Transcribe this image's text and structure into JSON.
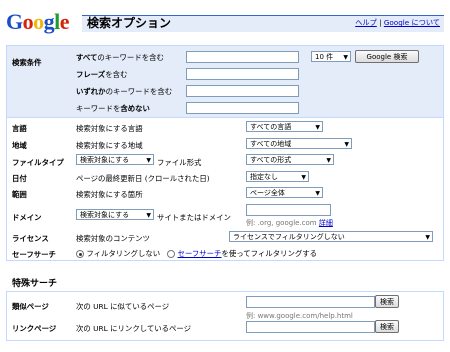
{
  "header": {
    "logo_letters": [
      "G",
      "o",
      "o",
      "g",
      "l",
      "e"
    ],
    "logo_colors": [
      "#1a4ec8",
      "#d62408",
      "#f2b50e",
      "#1a4ec8",
      "#1f9a2e",
      "#d62408"
    ],
    "title": "検索オプション",
    "help_link": "ヘルプ",
    "separator": "|",
    "about_link": "Google について"
  },
  "keywords": {
    "section_label": "検索条件",
    "rows": [
      {
        "bold": "すべて",
        "rest": "のキーワードを含む"
      },
      {
        "bold": "フレーズ",
        "rest": "を含む"
      },
      {
        "bold": "いずれか",
        "rest": "のキーワードを含む"
      },
      {
        "bold": "",
        "rest": "キーワードを",
        "bold2": "含めない"
      }
    ],
    "results_select": "10 件",
    "search_button": "Google 検索"
  },
  "options": [
    {
      "label": "言語",
      "desc": "検索対象にする言語",
      "select": "すべての言語"
    },
    {
      "label": "地域",
      "desc": "検索対象にする地域",
      "select": "すべての地域"
    },
    {
      "label": "ファイルタイプ",
      "pre_select": "検索対象にする",
      "desc": "ファイル形式",
      "select": "すべての形式"
    },
    {
      "label": "日付",
      "desc": "ページの最終更新日 (クロールされた日)",
      "select": "指定なし"
    },
    {
      "label": "範囲",
      "desc": "検索対象にする箇所",
      "select": "ページ全体"
    },
    {
      "label": "ドメイン",
      "pre_select": "検索対象にする",
      "desc": "サイトまたはドメイン"
    },
    {
      "label": "ライセンス",
      "desc": "検索対象のコンテンツ",
      "select": "ライセンスでフィルタリングしない"
    }
  ],
  "domain_hint": {
    "example": "例: .org, google.com",
    "detail_link": "詳細"
  },
  "safesearch": {
    "label": "セーフサーチ",
    "option_off": "フィルタリングしない",
    "option_on_link": "セーフサーチ",
    "option_on_rest": "を使ってフィルタリングする"
  },
  "special": {
    "title": "特殊サーチ",
    "rows": [
      {
        "label": "類似ページ",
        "desc": "次の URL に似ているページ",
        "button": "検索",
        "hint": "例: www.google.com/help.html"
      },
      {
        "label": "リンクページ",
        "desc": "次の URL にリンクしているページ",
        "button": "検索"
      }
    ]
  },
  "colors": {
    "accent": "#3366cc",
    "panel": "#e5ecf9",
    "link": "#0000cc"
  }
}
